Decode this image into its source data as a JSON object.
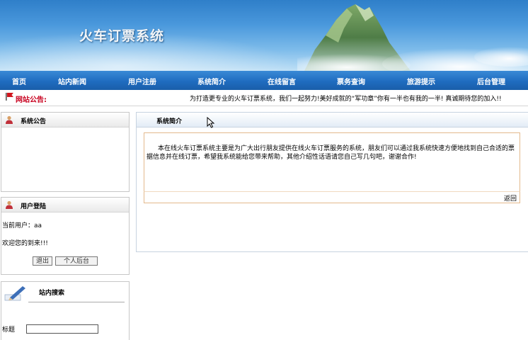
{
  "banner": {
    "title": "火车订票系统"
  },
  "nav": {
    "items": [
      "首页",
      "站内新闻",
      "用户注册",
      "系统简介",
      "在线留言",
      "票务查询",
      "旅游提示",
      "后台管理"
    ]
  },
  "notice": {
    "label": "网站公告:",
    "text": "为打造更专业的火车订票系统，我们一起努力!美好成就的“军功章”你有一半也有我的一半! 真诚期待您的加入!!"
  },
  "left": {
    "announcement": {
      "title": "系统公告"
    },
    "login": {
      "title": "用户登陆",
      "current_user_label": "当前用户：",
      "current_user": "aa",
      "welcome": "欢迎您的到来!!!",
      "logout_label": "退出",
      "backend_label": "个人后台"
    },
    "search": {
      "title": "站内搜索",
      "field_label": "标题",
      "field_value": ""
    }
  },
  "main": {
    "title": "系统简介",
    "body": "本在线火车订票系统主要是为广大出行朋友提供在线火车订票服务的系统，朋友们可以通过我系统快速方便地找到自己合适的票据信息并在线订票，希望我系统能给您带来帮助，其他介绍性话语请您自己写几句吧，谢谢合作!",
    "back_label": "返回"
  },
  "colors": {
    "nav": "#1f6cc0",
    "notice_label": "#c8001e",
    "content_border": "#e3b98c"
  }
}
